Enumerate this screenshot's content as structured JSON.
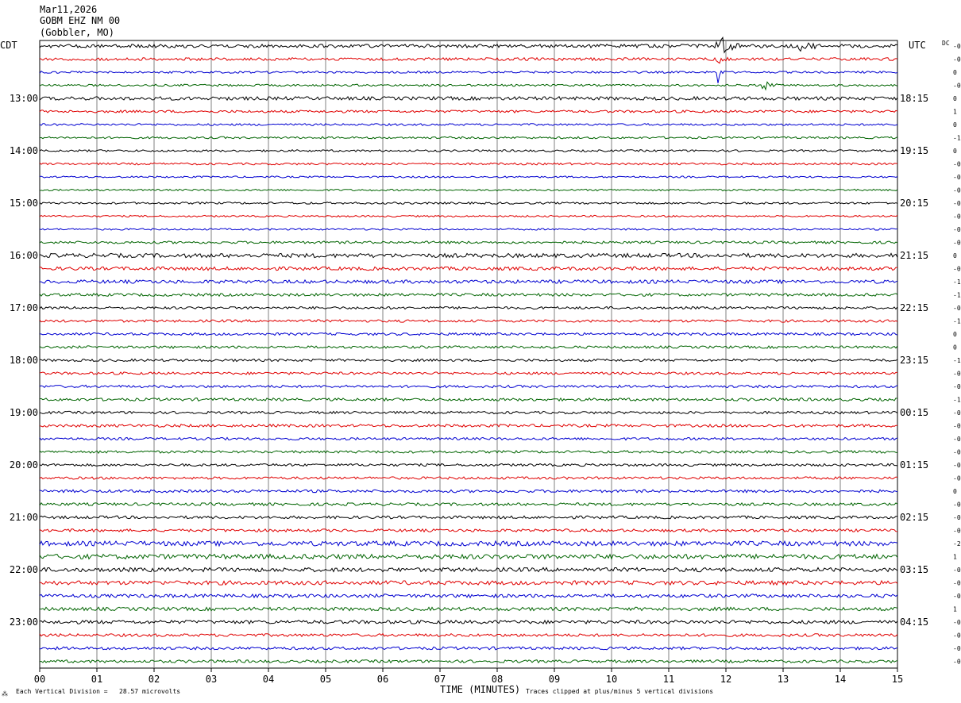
{
  "header": {
    "date": "Mar11,2026",
    "station": "GOBM EHZ NM 00",
    "location": "(Gobbler, MO)"
  },
  "left_zone_label": "CDT",
  "right_zone_label": "UTC",
  "dc_label": "DC",
  "colors": {
    "trace_cycle": [
      "#000000",
      "#e00000",
      "#0000d0",
      "#006400"
    ],
    "grid": "#808080"
  },
  "footer": {
    "scale_note": "Each Vertical Division =   28.57 microvolts",
    "xlabel": "TIME (MINUTES)",
    "clip_note": "Traces clipped at plus/minus 5 vertical divisions"
  },
  "chart_data": {
    "type": "line",
    "title": "",
    "xlabel": "TIME (MINUTES)",
    "ylabel": "",
    "x_range": [
      0,
      15
    ],
    "x_ticks": [
      "00",
      "01",
      "02",
      "03",
      "04",
      "05",
      "06",
      "07",
      "08",
      "09",
      "10",
      "11",
      "12",
      "13",
      "14",
      "15"
    ],
    "grid": true,
    "trace_count": 48,
    "minutes_per_trace": 15,
    "left_hour_labels": [
      "13:00",
      "14:00",
      "15:00",
      "16:00",
      "17:00",
      "18:00",
      "19:00",
      "20:00",
      "21:00",
      "22:00",
      "23:00"
    ],
    "right_hour_labels": [
      "18:15",
      "19:15",
      "20:15",
      "21:15",
      "22:15",
      "23:15",
      "00:15",
      "01:15",
      "02:15",
      "03:15",
      "04:15"
    ],
    "dc_offsets": [
      "-0",
      "-0",
      "0",
      "-0",
      "0",
      "1",
      "0",
      "-1",
      "0",
      "-0",
      "-0",
      "-0",
      "-0",
      "-0",
      "-0",
      "-0",
      "0",
      "-0",
      "-1",
      "-1",
      "-0",
      "-1",
      "0",
      "0",
      "-1",
      "-0",
      "-0",
      "-1",
      "-0",
      "-0",
      "-0",
      "-0",
      "-0",
      "-0",
      "0",
      "-0",
      "-0",
      "-0",
      "-2",
      "1",
      "-0",
      "-0",
      "-0",
      "1",
      "-0",
      "-0",
      "-0",
      "-0"
    ],
    "trace_noise_levels": [
      2.2,
      1.8,
      1.3,
      1.3,
      2.2,
      1.6,
      1.3,
      1.3,
      1.3,
      1.3,
      1.1,
      1.1,
      1.3,
      1.1,
      1.1,
      1.6,
      2.6,
      2.2,
      2.2,
      1.8,
      1.6,
      1.6,
      1.6,
      1.6,
      1.6,
      1.6,
      1.6,
      1.8,
      1.6,
      1.8,
      1.6,
      1.6,
      1.6,
      1.6,
      1.8,
      1.8,
      1.8,
      1.8,
      3.0,
      3.0,
      2.6,
      2.6,
      2.2,
      2.2,
      2.2,
      1.8,
      1.8,
      1.8
    ],
    "events": [
      {
        "trace": 0,
        "start_min": 11.8,
        "end_min": 12.4,
        "amplitude_divisions": 5
      },
      {
        "trace": 0,
        "start_min": 13.2,
        "end_min": 13.8,
        "amplitude_divisions": 4
      },
      {
        "trace": 1,
        "start_min": 11.8,
        "end_min": 12.1,
        "amplitude_divisions": 2
      },
      {
        "trace": 2,
        "start_min": 11.85,
        "end_min": 12.0,
        "amplitude_divisions": 4
      },
      {
        "trace": 3,
        "start_min": 12.6,
        "end_min": 13.0,
        "amplitude_divisions": 2
      }
    ]
  }
}
